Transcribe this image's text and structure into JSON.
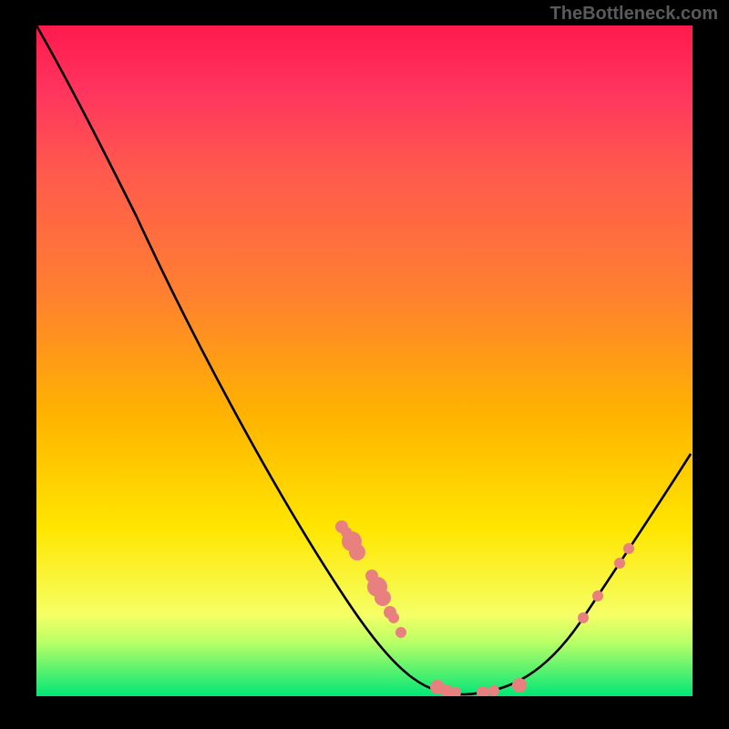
{
  "watermark": "TheBottleneck.com",
  "chart_data": {
    "type": "line",
    "title": "",
    "xlabel": "",
    "ylabel": "",
    "xlim": [
      0,
      100
    ],
    "ylim": [
      0,
      100
    ],
    "background": "vertical-gradient red→orange→yellow→green (top=worst, bottom=best)",
    "gradient_stops": [
      {
        "pos": 0.0,
        "color": "#ff1a4d"
      },
      {
        "pos": 0.1,
        "color": "#ff355e"
      },
      {
        "pos": 0.22,
        "color": "#ff5a4d"
      },
      {
        "pos": 0.4,
        "color": "#ff8030"
      },
      {
        "pos": 0.58,
        "color": "#ffb300"
      },
      {
        "pos": 0.75,
        "color": "#ffe600"
      },
      {
        "pos": 0.88,
        "color": "#f5ff66"
      },
      {
        "pos": 0.92,
        "color": "#b8ff66"
      },
      {
        "pos": 1.0,
        "color": "#00e676"
      }
    ],
    "series": [
      {
        "name": "bottleneck-curve",
        "color": "#000000",
        "x": [
          0,
          6,
          11,
          15,
          24,
          36,
          47,
          56,
          60,
          65,
          72,
          78,
          83,
          89,
          94,
          100
        ],
        "y": [
          100,
          90,
          82,
          72,
          54,
          31,
          15,
          2,
          0,
          0,
          1,
          3,
          12,
          20,
          28,
          36
        ]
      }
    ],
    "markers": {
      "name": "highlighted-points",
      "color": "#e88080",
      "points": [
        {
          "x": 47,
          "y": 25,
          "size": 7
        },
        {
          "x": 47,
          "y": 24,
          "size": 6
        },
        {
          "x": 48,
          "y": 23,
          "size": 11
        },
        {
          "x": 49,
          "y": 22,
          "size": 9
        },
        {
          "x": 51,
          "y": 18,
          "size": 7
        },
        {
          "x": 52,
          "y": 16,
          "size": 11
        },
        {
          "x": 53,
          "y": 15,
          "size": 9
        },
        {
          "x": 54,
          "y": 12,
          "size": 7
        },
        {
          "x": 54,
          "y": 12,
          "size": 6
        },
        {
          "x": 56,
          "y": 10,
          "size": 6
        },
        {
          "x": 61,
          "y": 1,
          "size": 8
        },
        {
          "x": 63,
          "y": 1,
          "size": 7
        },
        {
          "x": 64,
          "y": 1,
          "size": 6
        },
        {
          "x": 68,
          "y": 1,
          "size": 7
        },
        {
          "x": 70,
          "y": 1,
          "size": 6
        },
        {
          "x": 74,
          "y": 2,
          "size": 8
        },
        {
          "x": 83,
          "y": 12,
          "size": 6
        },
        {
          "x": 86,
          "y": 15,
          "size": 6
        },
        {
          "x": 89,
          "y": 20,
          "size": 6
        },
        {
          "x": 90,
          "y": 22,
          "size": 6
        }
      ]
    }
  }
}
